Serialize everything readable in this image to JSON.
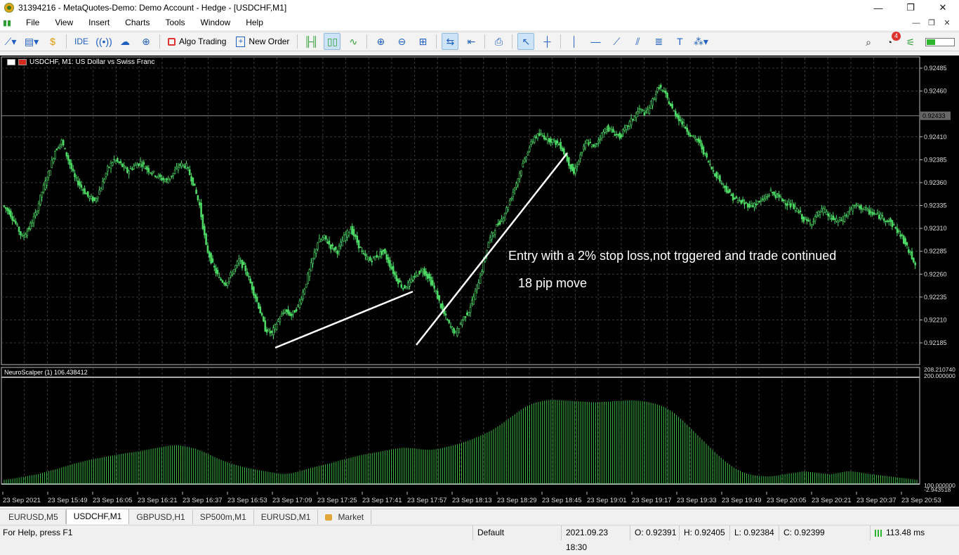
{
  "window": {
    "title": "31394216 - MetaQuotes-Demo: Demo Account - Hedge - [USDCHF,M1]",
    "minimize": "—",
    "maximize": "❐",
    "close": "✕"
  },
  "menu": {
    "items": [
      "File",
      "View",
      "Insert",
      "Charts",
      "Tools",
      "Window",
      "Help"
    ]
  },
  "toolbar": {
    "ide_label": "IDE",
    "algo_trading_label": "Algo Trading",
    "new_order_label": "New Order",
    "notification_count": "4"
  },
  "chart": {
    "symbol_label": "USDCHF, M1:  US Dollar vs Swiss Franc",
    "indicator_label": "NeuroScalper (1) 106.438412",
    "current_price": "0.92433",
    "price_ticks": [
      "0.92485",
      "0.92460",
      "0.92410",
      "0.92385",
      "0.92360",
      "0.92335",
      "0.92310",
      "0.92285",
      "0.92260",
      "0.92235",
      "0.92210",
      "0.92185"
    ],
    "indicator_ticks": [
      "208.210740",
      "200.000000",
      "100.000000",
      "-2.943518"
    ],
    "time_labels": [
      "23 Sep 2021",
      "23 Sep 15:49",
      "23 Sep 16:05",
      "23 Sep 16:21",
      "23 Sep 16:37",
      "23 Sep 16:53",
      "23 Sep 17:09",
      "23 Sep 17:25",
      "23 Sep 17:41",
      "23 Sep 17:57",
      "23 Sep 18:13",
      "23 Sep 18:29",
      "23 Sep 18:45",
      "23 Sep 19:01",
      "23 Sep 19:17",
      "23 Sep 19:33",
      "23 Sep 19:49",
      "23 Sep 20:05",
      "23 Sep 20:21",
      "23 Sep 20:37",
      "23 Sep 20:53"
    ],
    "annotation_1": "Entry with a 2% stop loss,not trggered and trade continued",
    "annotation_2": "18 pip move",
    "candle_color": "#4cd964",
    "price_path": [
      0.92335,
      0.92328,
      0.92315,
      0.923,
      0.9231,
      0.92325,
      0.9235,
      0.9237,
      0.92395,
      0.92405,
      0.92385,
      0.92365,
      0.92355,
      0.92345,
      0.9234,
      0.92355,
      0.92375,
      0.92385,
      0.9238,
      0.92372,
      0.92378,
      0.92382,
      0.92375,
      0.9237,
      0.92365,
      0.92362,
      0.9237,
      0.9238,
      0.92378,
      0.9236,
      0.92335,
      0.9229,
      0.9227,
      0.92255,
      0.9225,
      0.92262,
      0.92275,
      0.92265,
      0.92245,
      0.92225,
      0.922,
      0.92195,
      0.9221,
      0.9222,
      0.92215,
      0.92225,
      0.92245,
      0.9227,
      0.92295,
      0.923,
      0.9229,
      0.92285,
      0.923,
      0.9231,
      0.92295,
      0.9228,
      0.92275,
      0.9228,
      0.92285,
      0.9227,
      0.92255,
      0.92245,
      0.9225,
      0.9226,
      0.92265,
      0.92255,
      0.9224,
      0.9222,
      0.92205,
      0.92195,
      0.9221,
      0.9222,
      0.9224,
      0.92265,
      0.92295,
      0.9231,
      0.9232,
      0.92335,
      0.92355,
      0.92375,
      0.92395,
      0.9241,
      0.92412,
      0.92408,
      0.92405,
      0.924,
      0.92385,
      0.9237,
      0.9239,
      0.92405,
      0.92398,
      0.9241,
      0.9242,
      0.92415,
      0.9241,
      0.9242,
      0.9243,
      0.9244,
      0.92435,
      0.9245,
      0.92465,
      0.92455,
      0.9244,
      0.9243,
      0.9242,
      0.9241,
      0.92405,
      0.9239,
      0.92375,
      0.92365,
      0.92355,
      0.92345,
      0.9234,
      0.92337,
      0.92335,
      0.92338,
      0.92342,
      0.9235,
      0.92345,
      0.9234,
      0.92335,
      0.9233,
      0.9232,
      0.92315,
      0.92325,
      0.9233,
      0.92322,
      0.92318,
      0.9232,
      0.9233,
      0.92335,
      0.92332,
      0.92328,
      0.92325,
      0.92322,
      0.92318,
      0.9231,
      0.923,
      0.92285,
      0.92272
    ],
    "indicator_path": [
      8,
      10,
      13,
      16,
      19,
      24,
      28,
      33,
      38,
      42,
      46,
      49,
      52,
      55,
      58,
      60,
      63,
      66,
      69,
      72,
      73,
      70,
      66,
      60,
      52,
      45,
      39,
      34,
      30,
      27,
      24,
      21,
      19,
      20,
      24,
      29,
      33,
      37,
      41,
      46,
      50,
      54,
      57,
      60,
      63,
      66,
      68,
      67,
      65,
      64,
      66,
      70,
      74,
      79,
      85,
      92,
      100,
      110,
      122,
      134,
      145,
      152,
      156,
      158,
      157,
      156,
      155,
      154,
      153,
      154,
      155,
      156,
      157,
      156,
      154,
      150,
      144,
      134,
      120,
      104,
      88,
      72,
      56,
      42,
      30,
      22,
      17,
      15,
      14,
      16,
      19,
      21,
      24,
      22,
      20,
      18,
      21,
      24,
      23,
      20,
      18,
      16,
      14,
      12,
      10,
      8
    ]
  }
}
